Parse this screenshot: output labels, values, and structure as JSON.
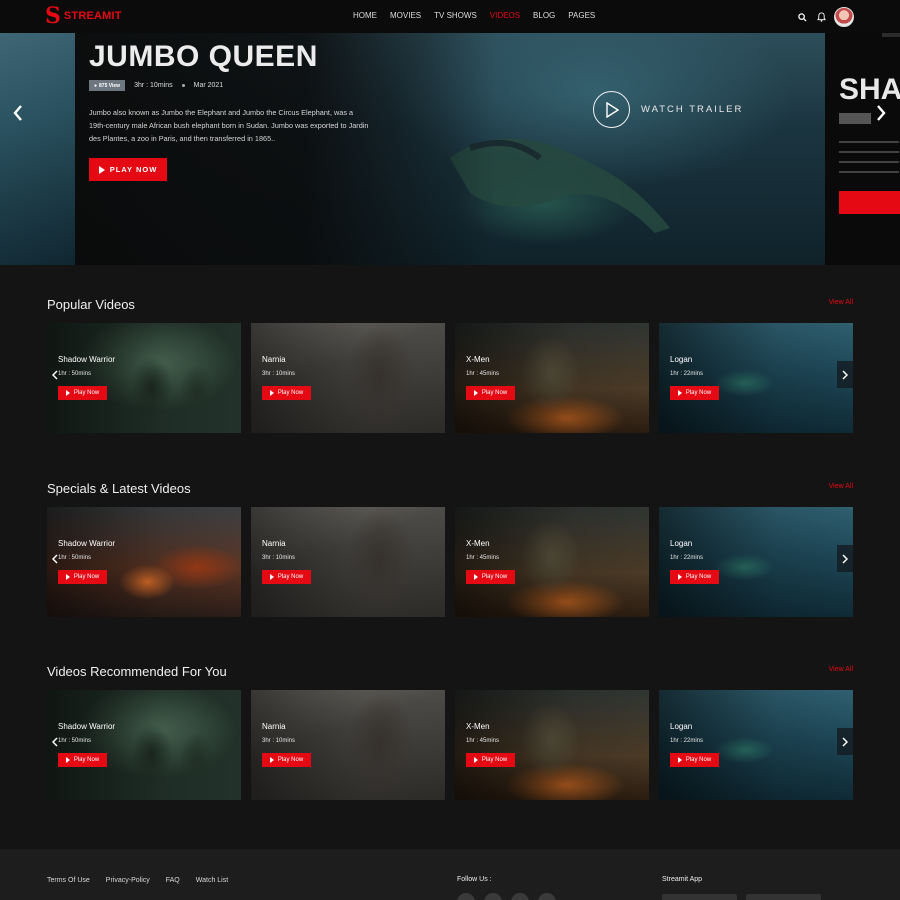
{
  "header": {
    "logo_mark": "S",
    "logo_text": "STREAMIT",
    "nav": [
      "HOME",
      "MOVIES",
      "TV SHOWS",
      "VIDEOS",
      "BLOG",
      "PAGES"
    ],
    "active_nav": "VIDEOS",
    "icons": [
      "search-icon",
      "bell-icon",
      "avatar"
    ]
  },
  "hero": {
    "title": "JUMBO QUEEN",
    "views": "875 View",
    "duration": "3hr : 10mins",
    "date": "Mar 2021",
    "description": "Jumbo also known as Jumbo the Elephant and Jumbo the Circus Elephant, was a 19th-century male African bush elephant born in Sudan. Jumbo was exported to Jardin des Plantes, a zoo in Paris, and then transferred in 1865..",
    "play_label": "PLAY NOW",
    "trailer_label": "WATCH TRAILER",
    "next_title": "SHA"
  },
  "sections": [
    {
      "title": "Popular Videos",
      "view_all": "View All",
      "cards": [
        {
          "title": "Shadow Warrior",
          "duration": "1hr : 50mins",
          "play": "Play Now",
          "bg": "bg-shadow"
        },
        {
          "title": "Narnia",
          "duration": "3hr : 10mins",
          "play": "Play Now",
          "bg": "bg-narnia"
        },
        {
          "title": "X-Men",
          "duration": "1hr : 45mins",
          "play": "Play Now",
          "bg": "bg-xmen"
        },
        {
          "title": "Logan",
          "duration": "1hr : 22mins",
          "play": "Play Now",
          "bg": "bg-logan"
        }
      ]
    },
    {
      "title": "Specials & Latest Videos",
      "view_all": "View All",
      "cards": [
        {
          "title": "Shadow Warrior",
          "duration": "1hr : 50mins",
          "play": "Play Now",
          "bg": "bg-ships"
        },
        {
          "title": "Narnia",
          "duration": "3hr : 10mins",
          "play": "Play Now",
          "bg": "bg-narnia"
        },
        {
          "title": "X-Men",
          "duration": "1hr : 45mins",
          "play": "Play Now",
          "bg": "bg-xmen"
        },
        {
          "title": "Logan",
          "duration": "1hr : 22mins",
          "play": "Play Now",
          "bg": "bg-logan"
        }
      ]
    },
    {
      "title": "Videos Recommended For You",
      "view_all": "View All",
      "cards": [
        {
          "title": "Shadow Warrior",
          "duration": "1hr : 50mins",
          "play": "Play Now",
          "bg": "bg-shadow"
        },
        {
          "title": "Narnia",
          "duration": "3hr : 10mins",
          "play": "Play Now",
          "bg": "bg-narnia"
        },
        {
          "title": "X-Men",
          "duration": "1hr : 45mins",
          "play": "Play Now",
          "bg": "bg-xmen"
        },
        {
          "title": "Logan",
          "duration": "1hr : 22mins",
          "play": "Play Now",
          "bg": "bg-logan"
        }
      ]
    }
  ],
  "footer": {
    "links": [
      "Terms Of Use",
      "Privacy-Policy",
      "FAQ",
      "Watch List"
    ],
    "follow_label": "Follow Us :",
    "app_label": "Streamit App"
  },
  "colors": {
    "accent": "#e50914",
    "background": "#141414",
    "header": "#0b0b0b",
    "footer": "#1d1d1d"
  }
}
